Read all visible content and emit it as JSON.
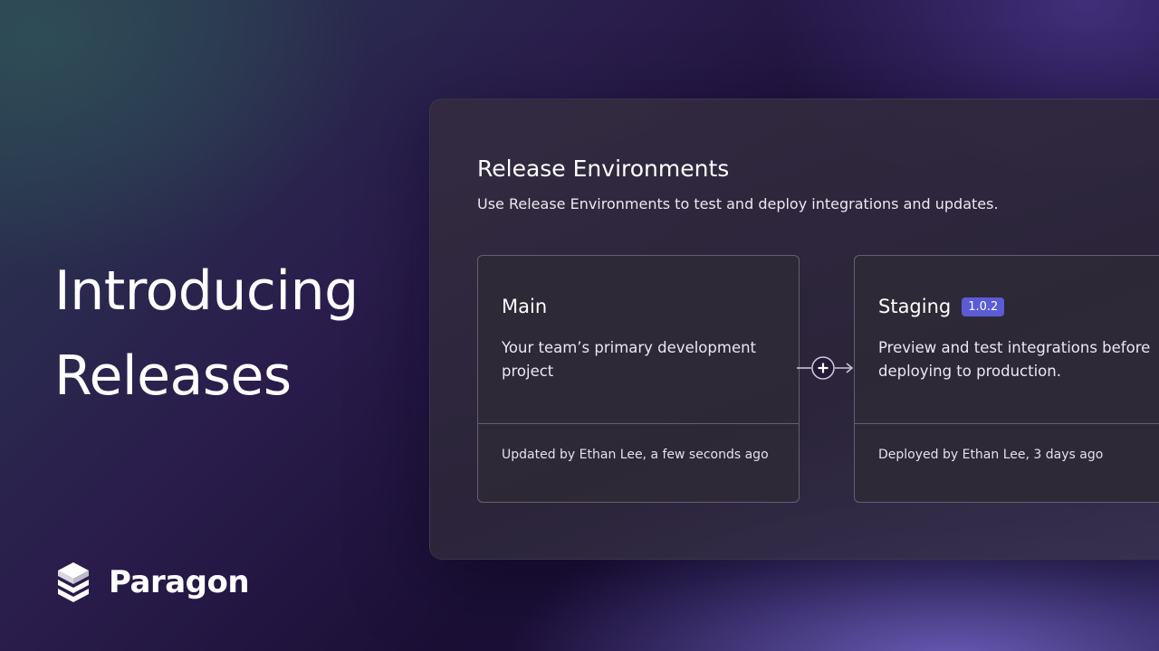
{
  "headline": {
    "line1": "Introducing",
    "line2": "Releases"
  },
  "brand": {
    "name": "Paragon",
    "logo_icon": "stacked-layers-icon"
  },
  "panel": {
    "title": "Release Environments",
    "subtitle": "Use Release Environments to test and deploy integrations and updates."
  },
  "environments": [
    {
      "name": "Main",
      "badge": "",
      "description": "Your team’s primary development project",
      "footer": "Updated by Ethan Lee, a few seconds ago"
    },
    {
      "name": "Staging",
      "badge": "1.0.2",
      "description": "Preview and test integrations before deploying to production.",
      "footer": "Deployed by Ethan Lee, 3 days ago"
    }
  ],
  "connector": {
    "icon": "plus-circle-icon",
    "arrow_icon": "arrow-right-icon"
  },
  "colors": {
    "badge_bg": "#5b5bd6",
    "card_border": "#aaa5be"
  }
}
